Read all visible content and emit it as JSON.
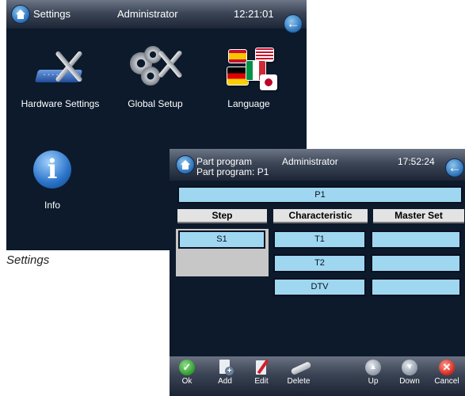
{
  "settings": {
    "title": "Settings",
    "user": "Administrator",
    "time": "12:21:01",
    "items": [
      {
        "label": "Hardware Settings",
        "icon": "hardware-settings-icon"
      },
      {
        "label": "Global Setup",
        "icon": "global-setup-icon"
      },
      {
        "label": "Language",
        "icon": "language-icon"
      },
      {
        "label": "Info",
        "icon": "info-icon"
      }
    ],
    "caption": "Settings"
  },
  "part_program": {
    "title": "Part program",
    "subtitle": "Part program: P1",
    "user": "Administrator",
    "time": "17:52:24",
    "program_name": "P1",
    "columns": [
      "Step",
      "Characteristic",
      "Master Set"
    ],
    "steps": [
      "S1"
    ],
    "characteristics": [
      "T1",
      "T2",
      "DTV"
    ],
    "master_sets": [
      "",
      "",
      ""
    ],
    "toolbar": [
      {
        "label": "Ok",
        "icon": "check-icon"
      },
      {
        "label": "Add",
        "icon": "add-document-icon"
      },
      {
        "label": "Edit",
        "icon": "edit-pencil-icon"
      },
      {
        "label": "Delete",
        "icon": "eraser-icon"
      },
      {
        "label": "Up",
        "icon": "arrow-up-icon"
      },
      {
        "label": "Down",
        "icon": "arrow-down-icon"
      },
      {
        "label": "Cancel",
        "icon": "cancel-icon"
      }
    ]
  },
  "colors": {
    "panel_bg": "#0c1a2c",
    "cell_fill": "#9fd7f0",
    "header_fill": "#e3e3e3",
    "accent_blue": "#2a6eb4"
  }
}
